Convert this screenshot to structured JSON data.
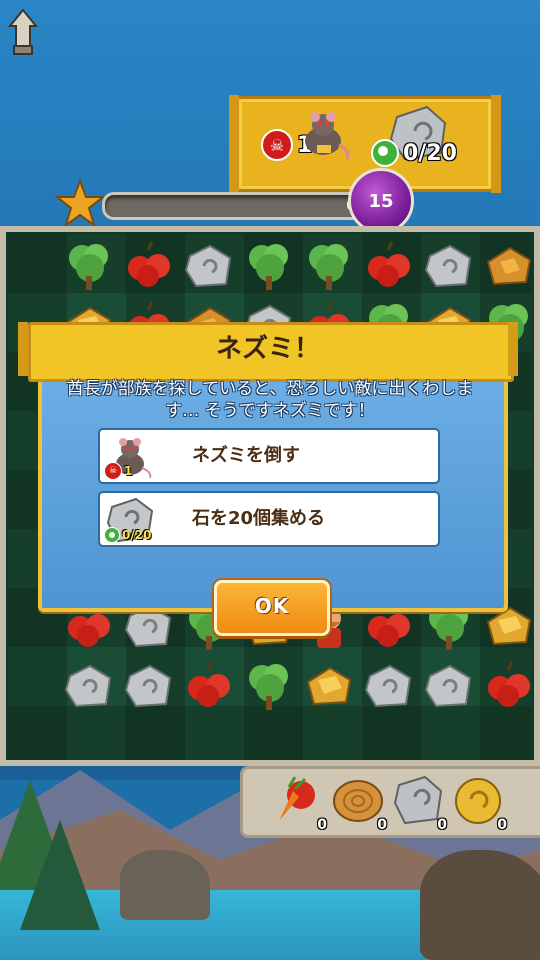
{
  "header": {
    "back_icon": "back-arrow-icon",
    "goals": {
      "enemy_icon": "rat-icon",
      "enemy_count": "1",
      "stone_icon": "stone-icon",
      "stone_progress": "0/20"
    },
    "score_progress": 0,
    "score_value": "0",
    "moves_left": "15"
  },
  "board": {
    "tiles": [
      "tree",
      "apple",
      "stone",
      "tree",
      "tree",
      "apple",
      "stone",
      "ore",
      "gold",
      "apple",
      "ore",
      "stone",
      "apple",
      "tree",
      "gold",
      "tree",
      "apple",
      "stone",
      "tree",
      "gold",
      "hero",
      "apple",
      "tree",
      "gold",
      "stone",
      "stone",
      "apple",
      "tree",
      "gold",
      "stone",
      "stone",
      "apple"
    ]
  },
  "boosters": [
    {
      "name": "vegetable-booster",
      "count": "0"
    },
    {
      "name": "log-booster",
      "count": "0"
    },
    {
      "name": "stone-booster",
      "count": "0"
    },
    {
      "name": "coin-booster",
      "count": "0"
    }
  ],
  "dialog": {
    "title": "ネズミ！",
    "description": "酋長が部族を探していると、恐ろしい敵に出くわします… そうですネズミです！",
    "objectives": [
      {
        "label": "ネズミを倒す",
        "icon": "rat-icon",
        "badge": "skull",
        "count": "1"
      },
      {
        "label": "石を20個集める",
        "icon": "stone-icon",
        "badge": "green",
        "count": "0/20"
      }
    ],
    "ok_label": "OK"
  },
  "colors": {
    "accent": "#f1c526",
    "dialog_blue": "#4f95d2",
    "ok_orange": "#f08a10"
  }
}
